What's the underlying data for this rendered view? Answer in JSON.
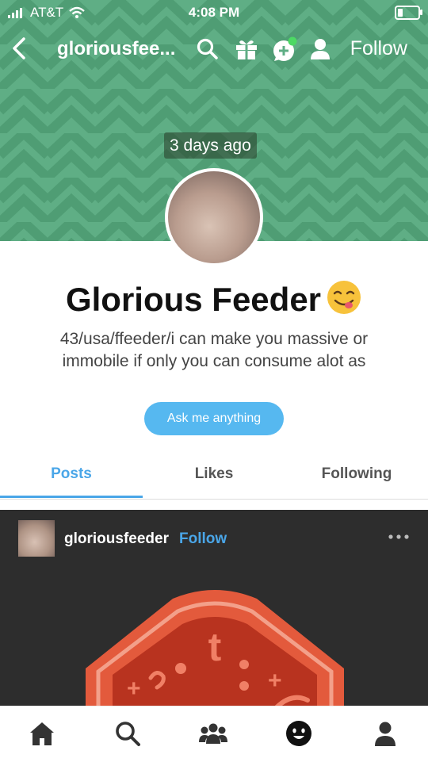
{
  "status_bar": {
    "carrier": "AT&T",
    "time": "4:08 PM"
  },
  "nav": {
    "title": "gloriousfee...",
    "follow_label": "Follow"
  },
  "header": {
    "time_ago": "3 days ago",
    "colors": {
      "background": "#5fae85",
      "chevron": "#4f9d74"
    }
  },
  "profile": {
    "name": "Glorious Feeder",
    "description": "43/usa/ffeeder/i can make you massive or immobile if only you can consume alot as",
    "ask_label": "Ask me anything"
  },
  "tabs": [
    {
      "label": "Posts",
      "active": true
    },
    {
      "label": "Likes",
      "active": false
    },
    {
      "label": "Following",
      "active": false
    }
  ],
  "post": {
    "username": "gloriousfeeder",
    "follow_label": "Follow",
    "graphic_letter": "t"
  },
  "bottom_nav": [
    "home-icon",
    "search-icon",
    "community-icon",
    "activity-icon",
    "account-icon"
  ],
  "colors": {
    "accent": "#4aa6e8",
    "button": "#56b8f0",
    "post_bg": "#2d2d2d",
    "notification_dot": "#4cd964"
  }
}
